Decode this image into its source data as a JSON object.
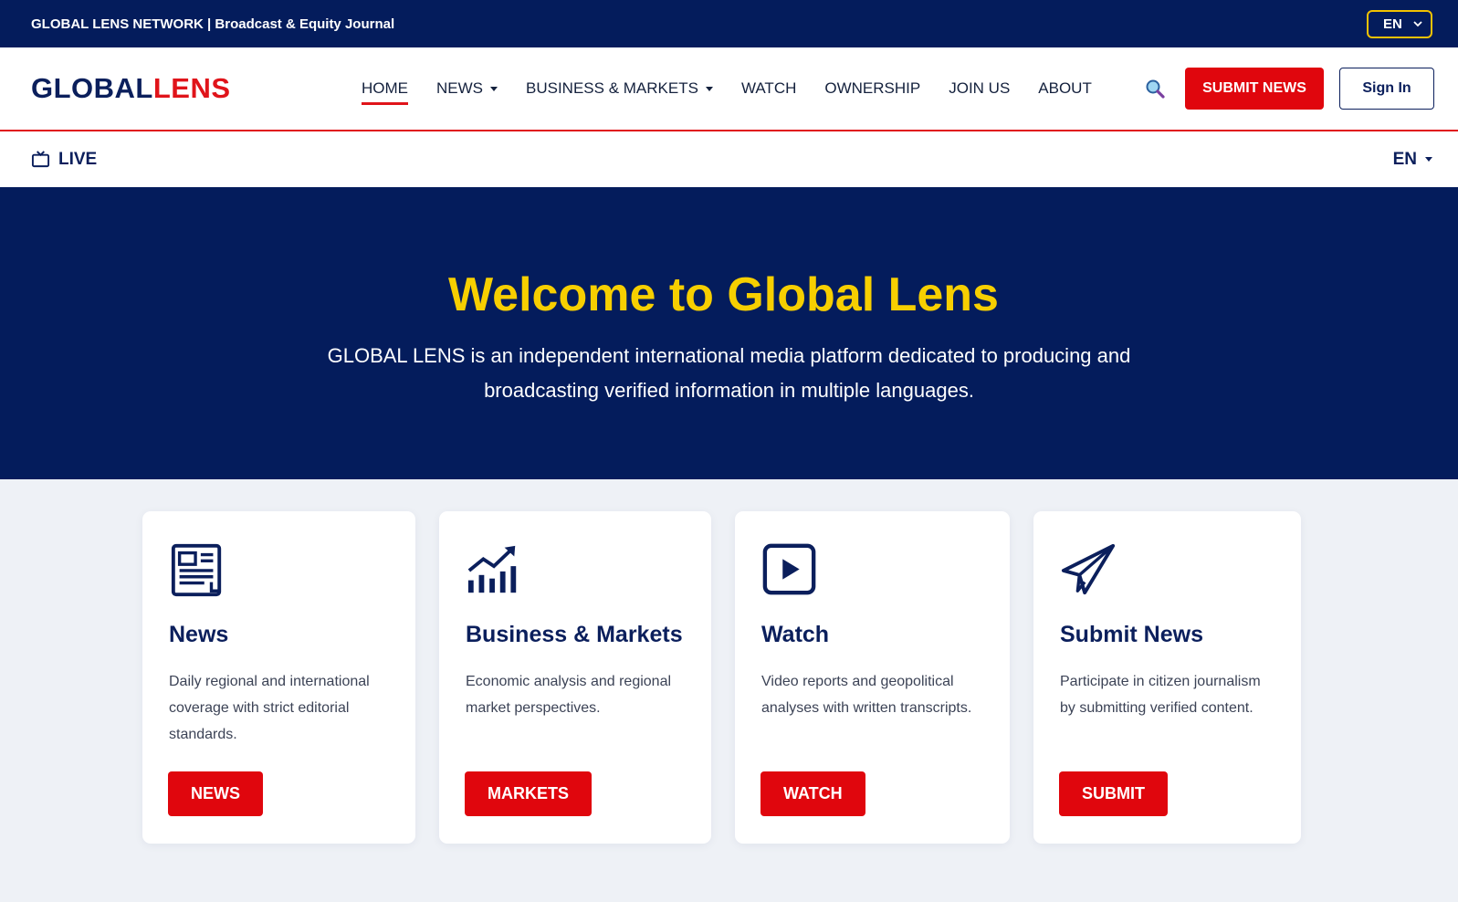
{
  "topbar": {
    "title": "GLOBAL LENS NETWORK | Broadcast & Equity Journal",
    "lang": "EN"
  },
  "brand": {
    "part1": "GLOBAL",
    "part2": "LENS",
    "color_primary": "#0b1f5c",
    "color_accent": "#e0141a"
  },
  "nav": {
    "items": [
      {
        "label": "HOME"
      },
      {
        "label": "NEWS"
      },
      {
        "label": "BUSINESS & MARKETS"
      },
      {
        "label": "WATCH"
      },
      {
        "label": "OWNERSHIP"
      },
      {
        "label": "JOIN US"
      },
      {
        "label": "ABOUT"
      }
    ],
    "search_icon": "search-icon",
    "submit_label": "SUBMIT NEWS",
    "signin_label": "Sign In"
  },
  "livebar": {
    "live_label": "LIVE",
    "lang": "EN"
  },
  "hero": {
    "title": "Welcome to Global Lens",
    "description": "GLOBAL LENS is an independent international media platform dedicated to producing and broadcasting verified information in multiple languages."
  },
  "cards": [
    {
      "icon": "newspaper-icon",
      "title": "News",
      "text": "Daily regional and international coverage with strict editorial standards.",
      "button": "NEWS"
    },
    {
      "icon": "chart-growth-icon",
      "title": "Business & Markets",
      "text": "Economic analysis and regional market perspectives.",
      "button": "MARKETS"
    },
    {
      "icon": "play-icon",
      "title": "Watch",
      "text": "Video reports and geopolitical analyses with written transcripts.",
      "button": "WATCH"
    },
    {
      "icon": "paper-plane-icon",
      "title": "Submit News",
      "text": "Participate in citizen journalism by submitting verified content.",
      "button": "SUBMIT"
    }
  ]
}
